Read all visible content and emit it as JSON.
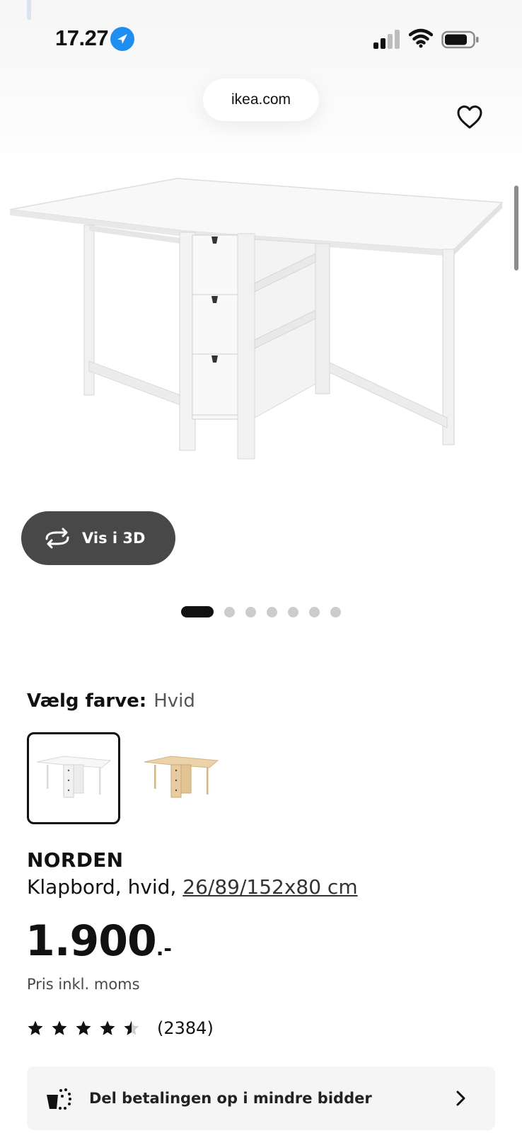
{
  "status_bar": {
    "time": "17.27"
  },
  "browser": {
    "url": "ikea.com"
  },
  "gallery": {
    "view_3d_label": "Vis i 3D",
    "image_count": 7,
    "active_index": 0
  },
  "color_picker": {
    "label": "Vælg farve:",
    "selected_value": "Hvid",
    "options": [
      "white-table-thumbnail",
      "birch-table-thumbnail"
    ]
  },
  "product": {
    "name": "NORDEN",
    "description_prefix": "Klapbord, hvid, ",
    "dimensions": "26/89/152x80 cm",
    "price": "1.900",
    "price_suffix": ".-",
    "price_note": "Pris inkl. moms",
    "rating": 4.5,
    "rating_max": 5,
    "review_count": "(2384)"
  },
  "installment": {
    "label": "Del betalingen op i mindre bidder"
  },
  "colors": {
    "accent_blue": "#1f8ef1",
    "button_dark": "#484848",
    "panel_grey": "#f5f5f5"
  }
}
